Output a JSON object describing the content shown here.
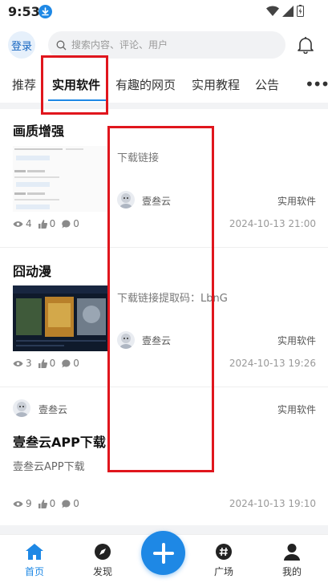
{
  "status_bar": {
    "time": "9:53"
  },
  "header": {
    "login_label": "登录",
    "search_placeholder": "搜索内容、评论、用户"
  },
  "tabs": [
    {
      "label": "推荐"
    },
    {
      "label": "实用软件"
    },
    {
      "label": "有趣的网页"
    },
    {
      "label": "实用教程"
    },
    {
      "label": "公告"
    }
  ],
  "posts": [
    {
      "title": "画质增强",
      "field_label": "下载链接",
      "author": "壹叁云",
      "category": "实用软件",
      "views": "4",
      "likes": "0",
      "comments": "0",
      "date": "2024-10-13 21:00"
    },
    {
      "title": "囧动漫",
      "field_label": "下载链接提取码：LbnG",
      "author": "壹叁云",
      "category": "实用软件",
      "views": "3",
      "likes": "0",
      "comments": "0",
      "date": "2024-10-13 19:26"
    },
    {
      "title": "壹叁云APP下载",
      "excerpt": "壹叁云APP下载",
      "author": "壹叁云",
      "category": "实用软件",
      "views": "9",
      "likes": "0",
      "comments": "0",
      "date": "2024-10-13 19:10"
    }
  ],
  "bottom_nav": [
    {
      "label": "首页",
      "icon": "home-icon"
    },
    {
      "label": "发现",
      "icon": "compass-icon"
    },
    {
      "label": "广场",
      "icon": "hash-icon"
    },
    {
      "label": "我的",
      "icon": "user-icon"
    }
  ],
  "colors": {
    "accent": "#1e88e5",
    "highlight": "#e0161d"
  }
}
